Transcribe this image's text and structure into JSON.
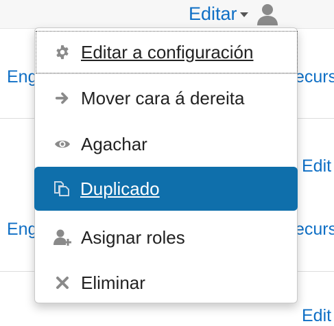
{
  "header": {
    "edit_label": "Editar"
  },
  "background": {
    "row1_left": "Eng",
    "row1_right": "ecurs",
    "row1b_right": "Edit",
    "row2_left": "Eng",
    "row2_right": "ecurs",
    "row2b_right": "Edit"
  },
  "menu": {
    "items": [
      {
        "label": "Editar a configuración",
        "icon": "gear-icon"
      },
      {
        "label": "Mover cara á dereita",
        "icon": "arrow-right-icon"
      },
      {
        "label": "Agachar",
        "icon": "eye-icon"
      },
      {
        "label": "Duplicado",
        "icon": "duplicate-icon"
      },
      {
        "label": "Asignar roles",
        "icon": "user-plus-icon"
      },
      {
        "label": "Eliminar",
        "icon": "delete-icon"
      }
    ]
  },
  "colors": {
    "link": "#0f6fc5",
    "active_bg": "#0f6fab",
    "icon_gray": "#8a8a8a"
  }
}
